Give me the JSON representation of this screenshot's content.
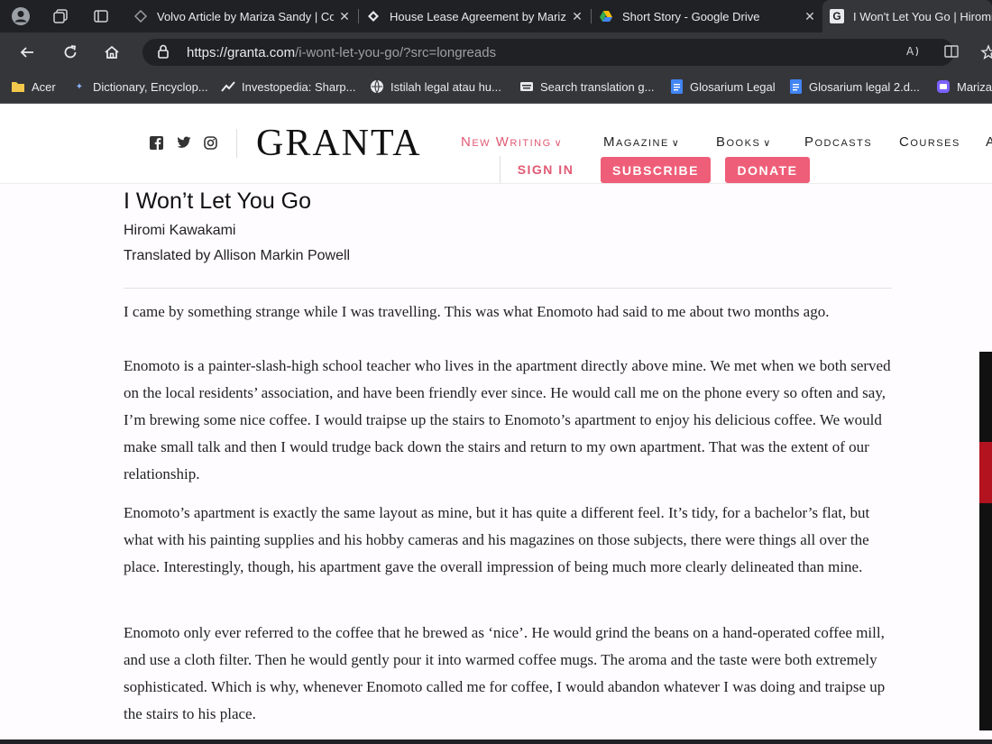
{
  "browser": {
    "tabs": [
      {
        "title": "Volvo Article by Mariza Sandy | Co"
      },
      {
        "title": "House Lease Agreement by Mariz"
      },
      {
        "title": "Short Story - Google Drive"
      },
      {
        "title": "I Won't Let You Go | Hiromi"
      }
    ],
    "url_host": "https://granta.com",
    "url_path": "/i-wont-let-you-go/?src=longreads",
    "bookmarks": [
      {
        "label": "Acer"
      },
      {
        "label": "Dictionary, Encyclop..."
      },
      {
        "label": "Investopedia: Sharp..."
      },
      {
        "label": "Istilah legal atau hu..."
      },
      {
        "label": "Search translation g..."
      },
      {
        "label": "Glosarium Legal"
      },
      {
        "label": "Glosarium legal 2.d..."
      },
      {
        "label": "Mariza"
      }
    ]
  },
  "site": {
    "logo": "GRANTA",
    "menu": {
      "new_writing": "New Writing",
      "magazine": "Magazine",
      "books": "Books",
      "podcasts": "Podcasts",
      "courses": "Courses",
      "overflow": "A"
    },
    "sign_in": "SIGN IN",
    "subscribe": "SUBSCRIBE",
    "donate": "DONATE"
  },
  "article": {
    "title": "I Won’t Let You Go",
    "author": "Hiromi Kawakami",
    "translator": "Translated by Allison Markin Powell",
    "paragraphs": [
      "I came by something strange while I was travelling. This was what Enomoto had said to me about two months ago.",
      "Enomoto is a painter-slash-high school teacher who lives in the apartment directly above mine. We met when we both served on the local residents’ association, and have been friendly ever since. He would call me on the phone every so often and say, I’m brewing some nice coffee. I would traipse up the stairs to Enomoto’s apartment to enjoy his delicious coffee. We would make small talk and then I would trudge back down the stairs and return to my own apartment. That was the extent of our relationship.",
      "Enomoto’s apartment is exactly the same layout as mine, but it has quite a different feel. It’s tidy, for a bachelor’s flat, but what with his painting supplies and his hobby cameras and his magazines on those subjects, there were things all over the place. Interestingly, though, his apartment gave the overall impression of being much more clearly delineated than mine.",
      "Enomoto only ever referred to the coffee that he brewed as ‘nice’. He would grind the beans on a hand-operated coffee mill, and use a cloth filter. Then he would gently pour it into warmed coffee mugs. The aroma and the taste were both extremely sophisticated. Which is why, whenever Enomoto called me for coffee, I would abandon whatever I was doing and traipse up the stairs to his place."
    ]
  },
  "colors": {
    "accent": "#e05a74",
    "button": "#ef5e78",
    "chrome_dark": "#202124",
    "chrome": "#35363a"
  },
  "icons": [
    "profile-icon",
    "workspaces-icon",
    "tab-actions-icon",
    "back-icon",
    "reload-icon",
    "home-icon",
    "lock-icon",
    "read-aloud-icon",
    "reader-mode-icon",
    "favorite-icon",
    "facebook-icon",
    "twitter-icon",
    "instagram-icon"
  ]
}
